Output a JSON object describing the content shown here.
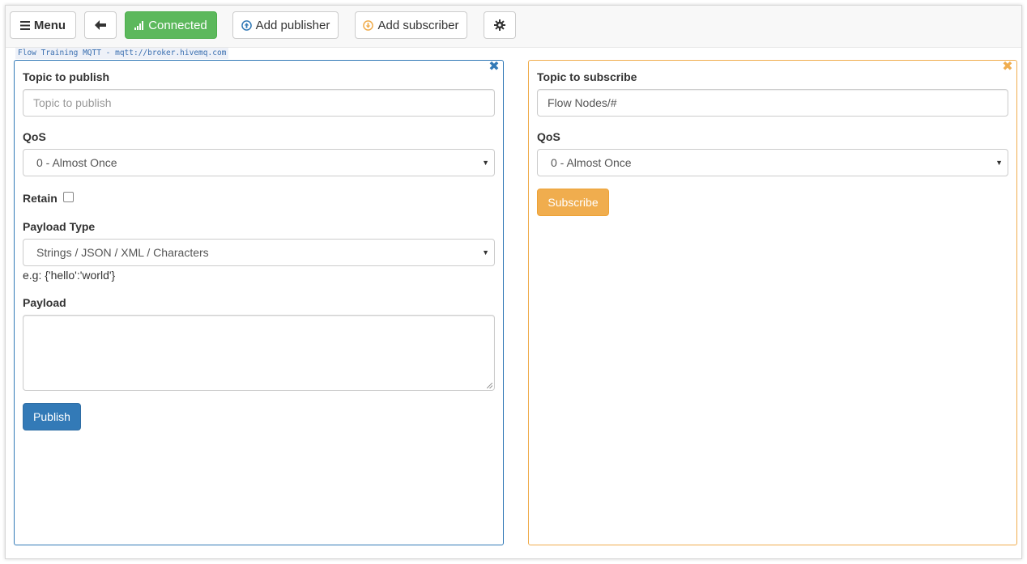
{
  "toolbar": {
    "menu_label": "Menu",
    "connected_label": "Connected",
    "add_publisher_label": "Add publisher",
    "add_subscriber_label": "Add subscriber"
  },
  "connection": {
    "broker_label": "Flow Training MQTT - mqtt://broker.hivemq.com"
  },
  "publisher": {
    "topic_label": "Topic to publish",
    "topic_placeholder": "Topic to publish",
    "qos_label": "QoS",
    "qos_value": "0 - Almost Once",
    "retain_label": "Retain",
    "retain_checked": false,
    "payload_type_label": "Payload Type",
    "payload_type_value": "Strings / JSON / XML / Characters",
    "payload_example": "e.g: {'hello':'world'}",
    "payload_label": "Payload",
    "payload_value": "",
    "publish_label": "Publish"
  },
  "subscriber": {
    "topic_label": "Topic to subscribe",
    "topic_value": "Flow Nodes/#",
    "qos_label": "QoS",
    "qos_value": "0 - Almost Once",
    "subscribe_label": "Subscribe"
  },
  "colors": {
    "publisher_accent": "#337ab7",
    "subscriber_accent": "#f0ad4e",
    "connected": "#5cb85c"
  },
  "icons": {
    "menu": "hamburger-icon",
    "back": "arrow-left-icon",
    "connected": "signal-icon",
    "add_publisher": "circle-arrow-up-icon",
    "add_subscriber": "circle-arrow-down-icon",
    "settings": "gear-icon",
    "close": "close-icon"
  }
}
